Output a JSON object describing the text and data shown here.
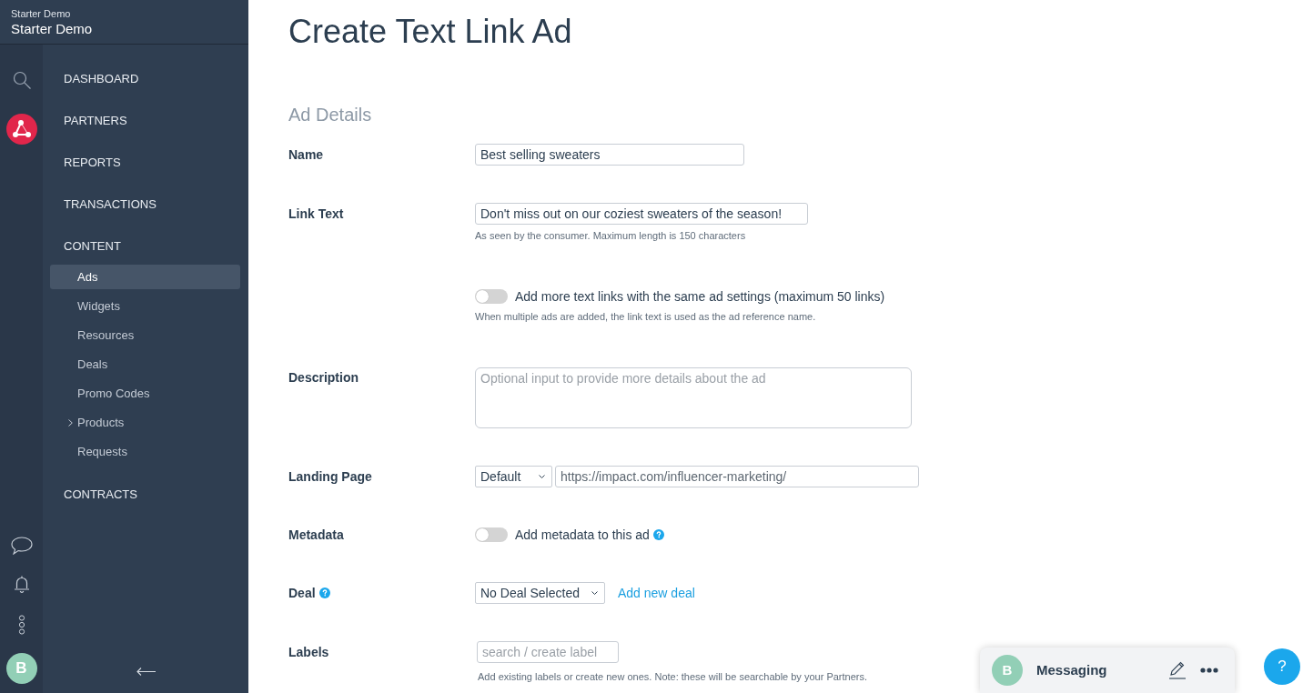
{
  "sidebar": {
    "workspace": "Starter Demo",
    "account": "Starter Demo",
    "avatar": "B",
    "nav": [
      {
        "label": "DASHBOARD"
      },
      {
        "label": "PARTNERS"
      },
      {
        "label": "REPORTS"
      },
      {
        "label": "TRANSACTIONS"
      },
      {
        "label": "CONTENT",
        "children": [
          {
            "label": "Ads",
            "kind": "link",
            "selected": true
          },
          {
            "label": "Widgets",
            "kind": "link",
            "selected": false
          },
          {
            "label": "Resources",
            "kind": "link",
            "selected": false
          },
          {
            "label": "Deals",
            "kind": "link",
            "selected": false
          },
          {
            "label": "Promo Codes",
            "kind": "link",
            "selected": false
          },
          {
            "label": "Products",
            "kind": "group",
            "selected": false
          },
          {
            "label": "Requests",
            "kind": "link",
            "selected": false
          }
        ]
      },
      {
        "label": "CONTRACTS"
      }
    ]
  },
  "page": {
    "title": "Create Text Link Ad",
    "section": "Ad Details",
    "fields": [
      {
        "kind": "text",
        "label": "Name",
        "value": "Best selling sweaters"
      },
      {
        "kind": "text",
        "label": "Link Text",
        "value": "Don't miss out on our coziest sweaters of the season!",
        "hint": "As seen by the consumer. Maximum length is 150 characters"
      },
      {
        "kind": "toggle",
        "text": "Add more text links with the same ad settings (maximum 50 links)",
        "on": false,
        "hint": "When multiple ads are added, the link text is used as the ad reference name."
      },
      {
        "kind": "textarea",
        "label": "Description",
        "placeholder": "Optional input to provide more details about the ad"
      },
      {
        "kind": "url",
        "label": "Landing Page",
        "select": "Default",
        "value": "https://impact.com/influencer-marketing/"
      },
      {
        "kind": "toggle",
        "label": "Metadata",
        "text": "Add metadata to this ad",
        "on": false,
        "help": true
      },
      {
        "kind": "select",
        "label": "Deal",
        "help": true,
        "select": "No Deal Selected",
        "link": "Add new deal"
      },
      {
        "kind": "tags",
        "label": "Labels",
        "placeholder": "search / create label",
        "hint": "Add existing labels or create new ones. Note: these will be searchable by your Partners."
      }
    ]
  },
  "messaging": {
    "avatar": "B",
    "title": "Messaging"
  },
  "help_button": "?"
}
